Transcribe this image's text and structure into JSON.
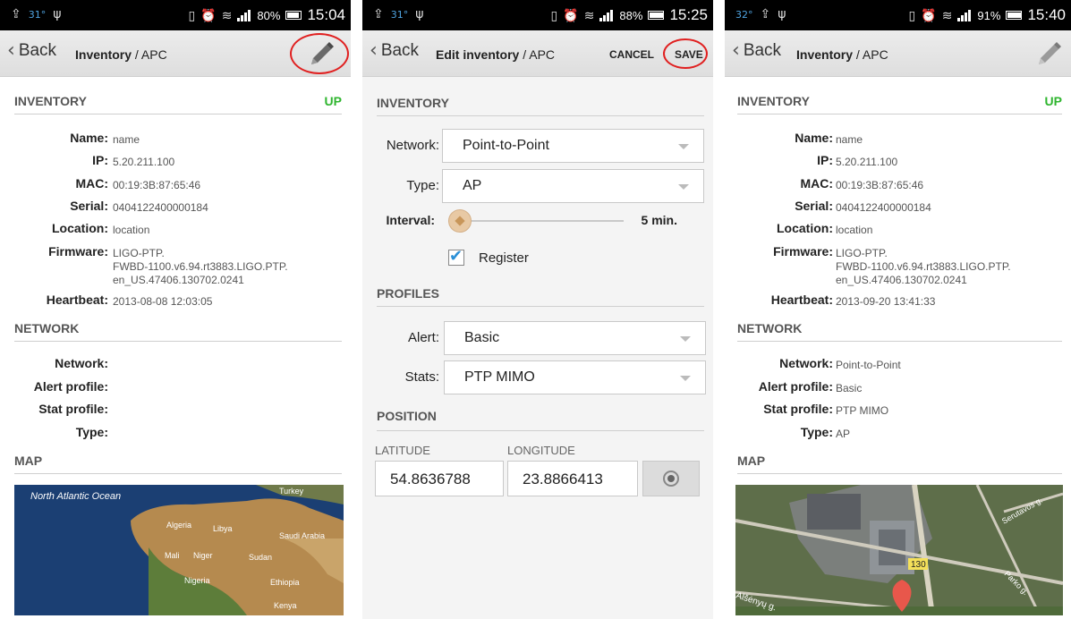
{
  "status_bars": [
    {
      "temp": "31°",
      "battery": "80%",
      "time": "15:04"
    },
    {
      "temp": "31°",
      "battery": "88%",
      "time": "15:25"
    },
    {
      "temp": "32°",
      "battery": "91%",
      "time": "15:40"
    }
  ],
  "colors": {
    "status_up": "#2fb52f",
    "highlight_ring": "#e02020",
    "checkbox_check": "#2a8fd6"
  },
  "screen1": {
    "back_label": "Back",
    "title_bold": "Inventory",
    "title_sub": " / APC",
    "edit_icon": "pencil-icon",
    "inventory_header": "INVENTORY",
    "status": "UP",
    "fields": [
      {
        "label": "Name:",
        "value": "name"
      },
      {
        "label": "IP:",
        "value": "5.20.211.100"
      },
      {
        "label": "MAC:",
        "value": "00:19:3B:87:65:46"
      },
      {
        "label": "Serial:",
        "value": "0404122400000184"
      },
      {
        "label": "Location:",
        "value": "location"
      },
      {
        "label": "Firmware:",
        "value": "LIGO-PTP.\nFWBD-1100.v6.94.rt3883.LIGO.PTP.\nen_US.47406.130702.0241"
      },
      {
        "label": "Heartbeat:",
        "value": "2013-08-08 12:03:05"
      }
    ],
    "network_header": "NETWORK",
    "network_fields": [
      {
        "label": "Network:",
        "value": ""
      },
      {
        "label": "Alert profile:",
        "value": ""
      },
      {
        "label": "Stat profile:",
        "value": ""
      },
      {
        "label": "Type:",
        "value": ""
      }
    ],
    "map_header": "MAP",
    "map_labels": [
      "North Atlantic\nOcean",
      "Algeria",
      "Libya",
      "Mali",
      "Niger",
      "Sudan",
      "Saudi Arabia",
      "Nigeria",
      "Ethiopia",
      "Kenya",
      "Turkey"
    ]
  },
  "screen2": {
    "back_label": "Back",
    "title_bold": "Edit inventory",
    "title_sub": " / APC",
    "cancel_label": "CANCEL",
    "save_label": "SAVE",
    "inventory_header": "INVENTORY",
    "network_label": "Network:",
    "network_value": "Point-to-Point",
    "type_label": "Type:",
    "type_value": "AP",
    "interval_label": "Interval:",
    "interval_value": "5 min.",
    "register_label": "Register",
    "profiles_header": "PROFILES",
    "alert_label": "Alert:",
    "alert_value": "Basic",
    "stats_label": "Stats:",
    "stats_value": "PTP MIMO",
    "position_header": "POSITION",
    "latitude_label": "LATITUDE",
    "longitude_label": "LONGITUDE",
    "latitude_value": "54.8636788",
    "longitude_value": "23.8866413"
  },
  "screen3": {
    "back_label": "Back",
    "title_bold": "Inventory",
    "title_sub": " / APC",
    "inventory_header": "INVENTORY",
    "status": "UP",
    "fields": [
      {
        "label": "Name:",
        "value": "name"
      },
      {
        "label": "IP:",
        "value": "5.20.211.100"
      },
      {
        "label": "MAC:",
        "value": "00:19:3B:87:65:46"
      },
      {
        "label": "Serial:",
        "value": "0404122400000184"
      },
      {
        "label": "Location:",
        "value": "location"
      },
      {
        "label": "Firmware:",
        "value": "LIGO-PTP.\nFWBD-1100.v6.94.rt3883.LIGO.PTP.\nen_US.47406.130702.0241"
      },
      {
        "label": "Heartbeat:",
        "value": "2013-09-20 13:41:33"
      }
    ],
    "network_header": "NETWORK",
    "network_fields": [
      {
        "label": "Network:",
        "value": "Point-to-Point"
      },
      {
        "label": "Alert profile:",
        "value": "Basic"
      },
      {
        "label": "Stat profile:",
        "value": "PTP MIMO"
      },
      {
        "label": "Type:",
        "value": "AP"
      }
    ],
    "map_header": "MAP",
    "map_labels": [
      "Alšėnyų g.",
      "130",
      "Serutavos g.",
      "Parko g."
    ]
  }
}
